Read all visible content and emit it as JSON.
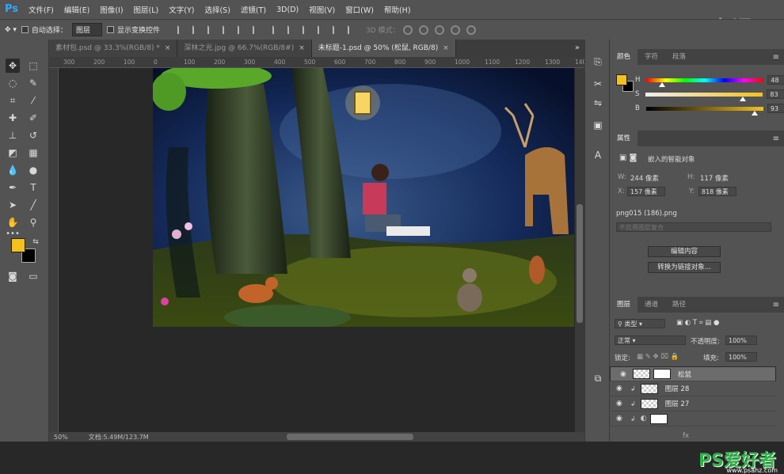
{
  "app": {
    "logo": "Ps"
  },
  "menu": [
    "文件(F)",
    "编辑(E)",
    "图像(I)",
    "图层(L)",
    "文字(Y)",
    "选择(S)",
    "滤镜(T)",
    "3D(D)",
    "视图(V)",
    "窗口(W)",
    "帮助(H)"
  ],
  "options": {
    "auto_select_label": "自动选择：",
    "auto_select_value": "图层",
    "show_transform_label": "显示变换控件",
    "mode_3d_label": "3D 模式："
  },
  "tabs": [
    {
      "label": "素材包.psd @ 33.3%(RGB/8) *"
    },
    {
      "label": "深林之光.jpg @ 66.7%(RGB/8#)"
    },
    {
      "label": "未标题-1.psd @ 50% (松鼠, RGB/8)"
    }
  ],
  "ruler_ticks": [
    "300",
    "200",
    "100",
    "0",
    "100",
    "200",
    "300",
    "400",
    "500",
    "600",
    "700",
    "800",
    "900",
    "1000",
    "1100",
    "1200",
    "1300",
    "1400"
  ],
  "status": {
    "zoom": "50%",
    "doc": "文档:5.49M/123.7M"
  },
  "color_panel": {
    "tabs": [
      "颜色",
      "字符",
      "段落"
    ],
    "h_label": "H",
    "h_value": "48",
    "h_unit": "°",
    "h_pos": 0.13,
    "s_label": "S",
    "s_value": "83",
    "s_unit": "%",
    "s_pos": 0.83,
    "b_label": "B",
    "b_value": "93",
    "b_unit": "%",
    "b_pos": 0.93,
    "fg_color": "#f4c01e"
  },
  "properties": {
    "title": "属性",
    "object_type": "嵌入的智能对象",
    "w_label": "W:",
    "w_value": "244 像素",
    "h_label": "H:",
    "h_value": "117 像素",
    "x_label": "X:",
    "x_value": "157 像素",
    "y_label": "Y:",
    "y_value": "818 像素",
    "filename": "png015 (186).png",
    "comp_placeholder": "不应用图层复合",
    "edit_button": "编辑内容",
    "convert_button": "转换为链接对象..."
  },
  "layers": {
    "tabs": [
      "图层",
      "通道",
      "路径"
    ],
    "filter_kind": "类型",
    "blend_mode": "正常",
    "opacity_label": "不透明度:",
    "opacity_value": "100%",
    "lock_label": "锁定:",
    "fill_label": "填充:",
    "fill_value": "100%",
    "rows": [
      {
        "name": "松鼠"
      },
      {
        "name": "图层 28"
      },
      {
        "name": "图层 27"
      },
      {
        "name": ""
      }
    ]
  },
  "watermark": {
    "top": "虎课网",
    "bottom": "PS爱好者",
    "url": "www.psahz.com"
  },
  "colors": {
    "accent": "#31a8ff",
    "panel": "#535353",
    "dark": "#282828"
  }
}
